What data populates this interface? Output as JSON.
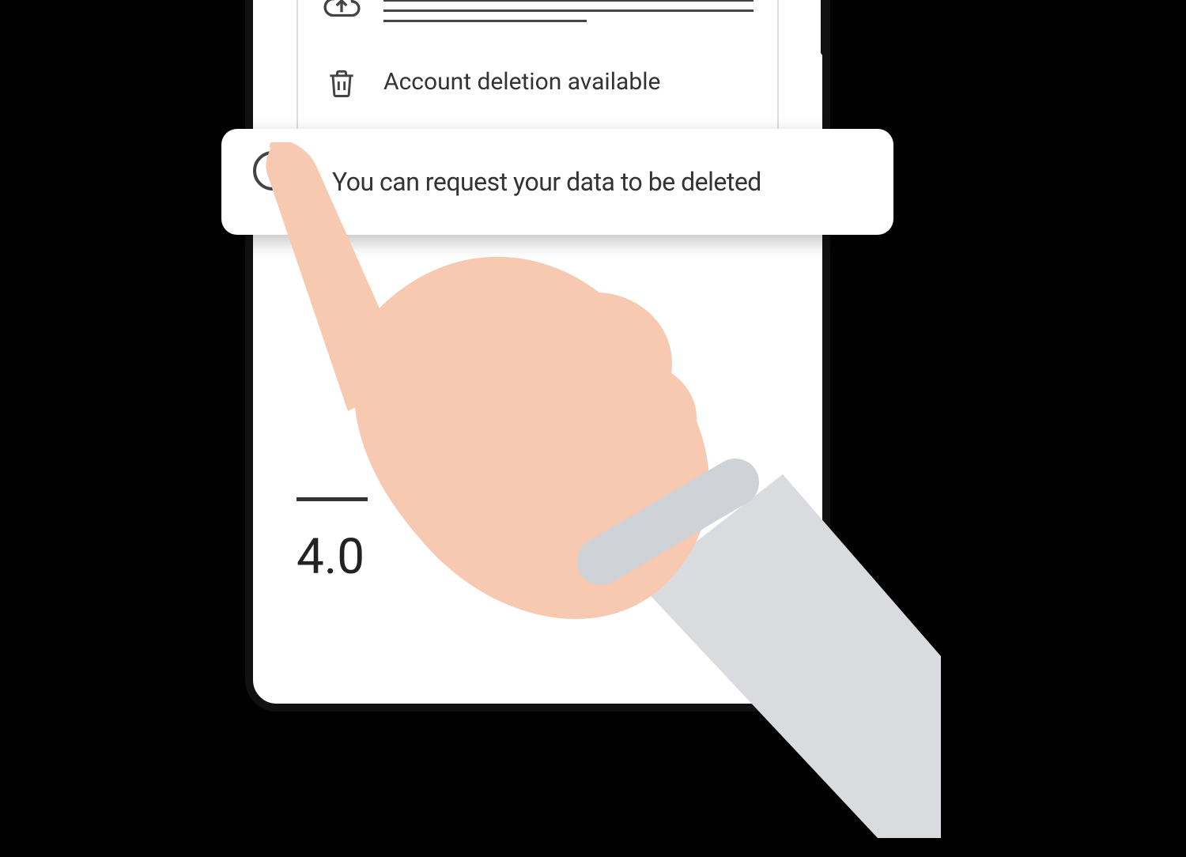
{
  "list": {
    "account_deletion_title": "Account deletion available"
  },
  "popup": {
    "text": "You can request your data to be deleted"
  },
  "rating": {
    "value": "4.0"
  }
}
